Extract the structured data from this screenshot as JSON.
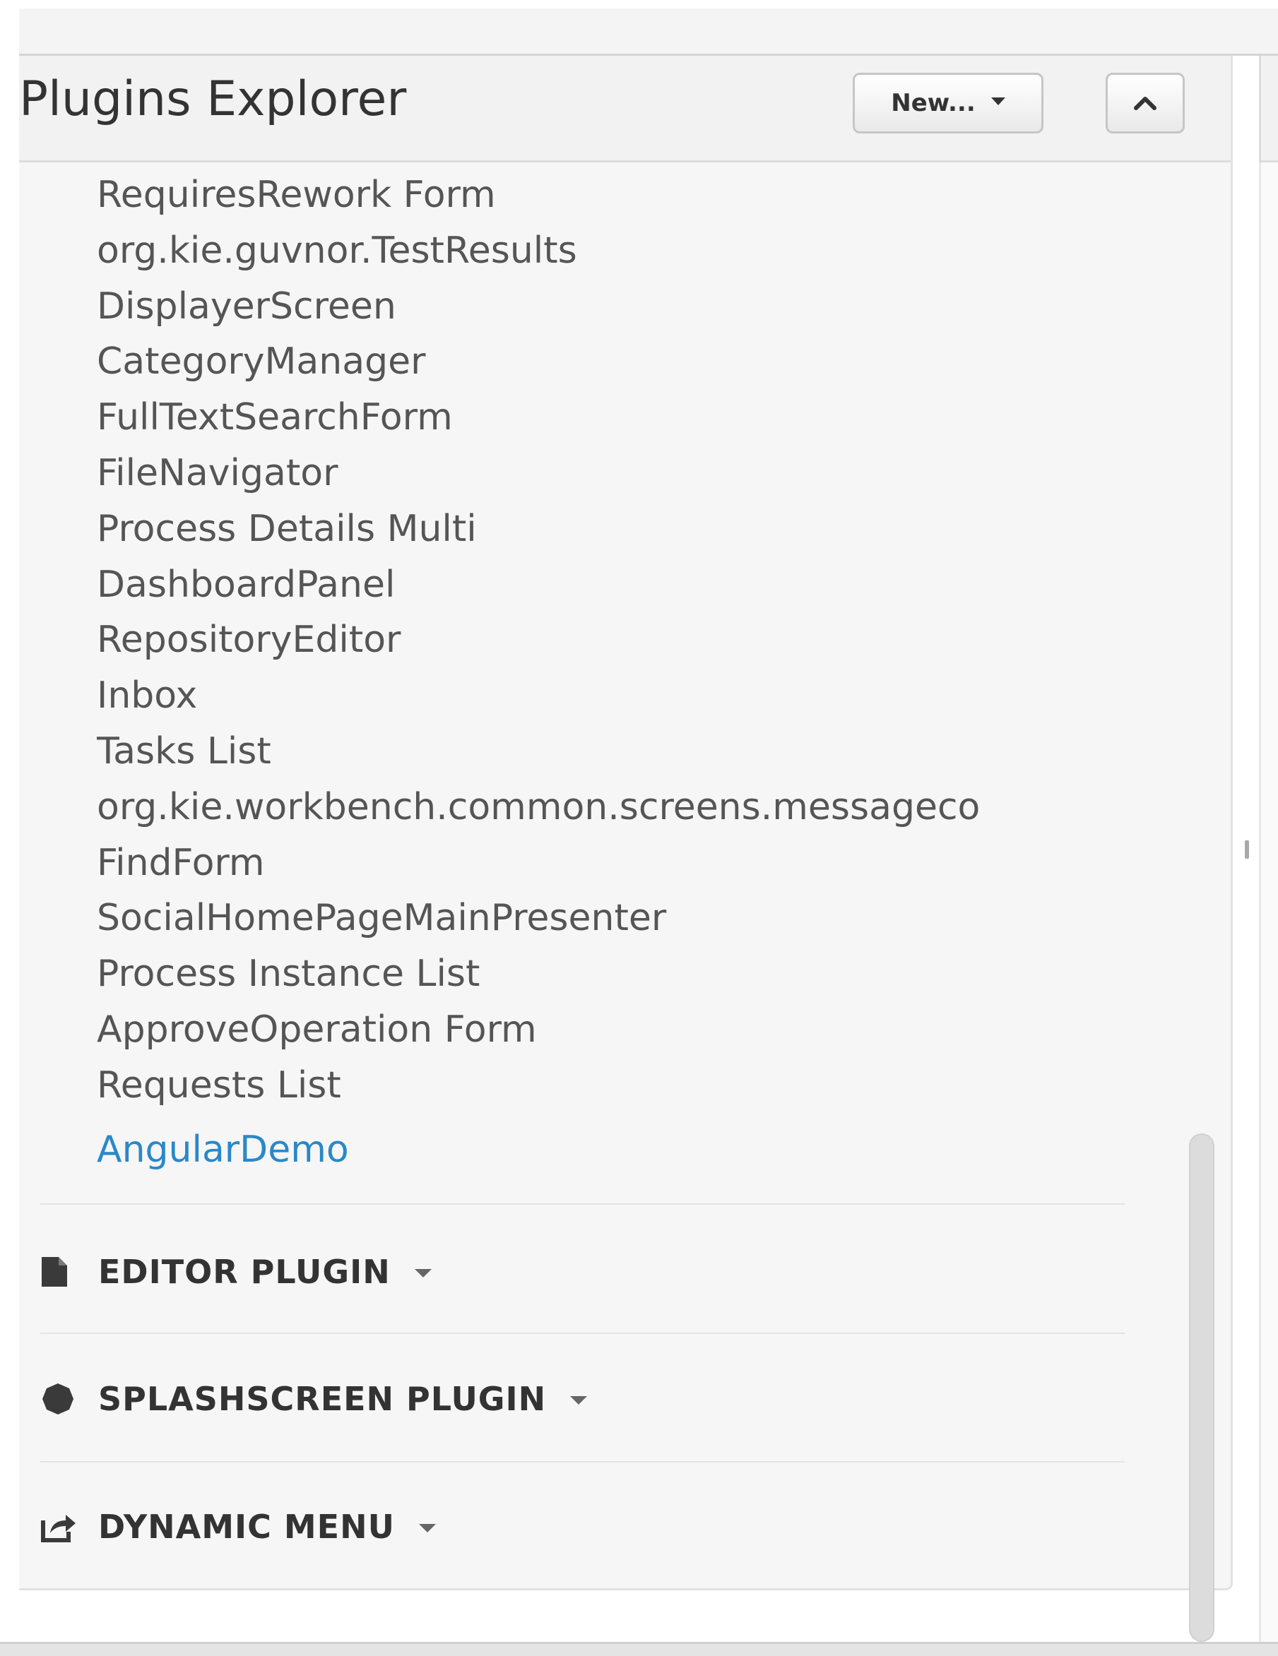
{
  "panel": {
    "title": "Plugins Explorer",
    "new_button_label": "New...",
    "collapse_icon": "chevron-up-icon"
  },
  "plugins": {
    "items": [
      "RequiresRework Form",
      "org.kie.guvnor.TestResults",
      "DisplayerScreen",
      "CategoryManager",
      "FullTextSearchForm",
      "FileNavigator",
      "Process Details Multi",
      "DashboardPanel",
      "RepositoryEditor",
      "Inbox",
      "Tasks List",
      "org.kie.workbench.common.screens.messageco",
      "FindForm",
      "SocialHomePageMainPresenter",
      "Process Instance List",
      "ApproveOperation Form",
      "Requests List",
      "AngularDemo"
    ],
    "active_item": "AngularDemo",
    "active_color": "#2a88c8"
  },
  "sections": [
    {
      "label": "EDITOR PLUGIN",
      "icon": "file-icon"
    },
    {
      "label": "SPLASHSCREEN PLUGIN",
      "icon": "circle-icon"
    },
    {
      "label": "DYNAMIC MENU",
      "icon": "share-icon"
    }
  ]
}
